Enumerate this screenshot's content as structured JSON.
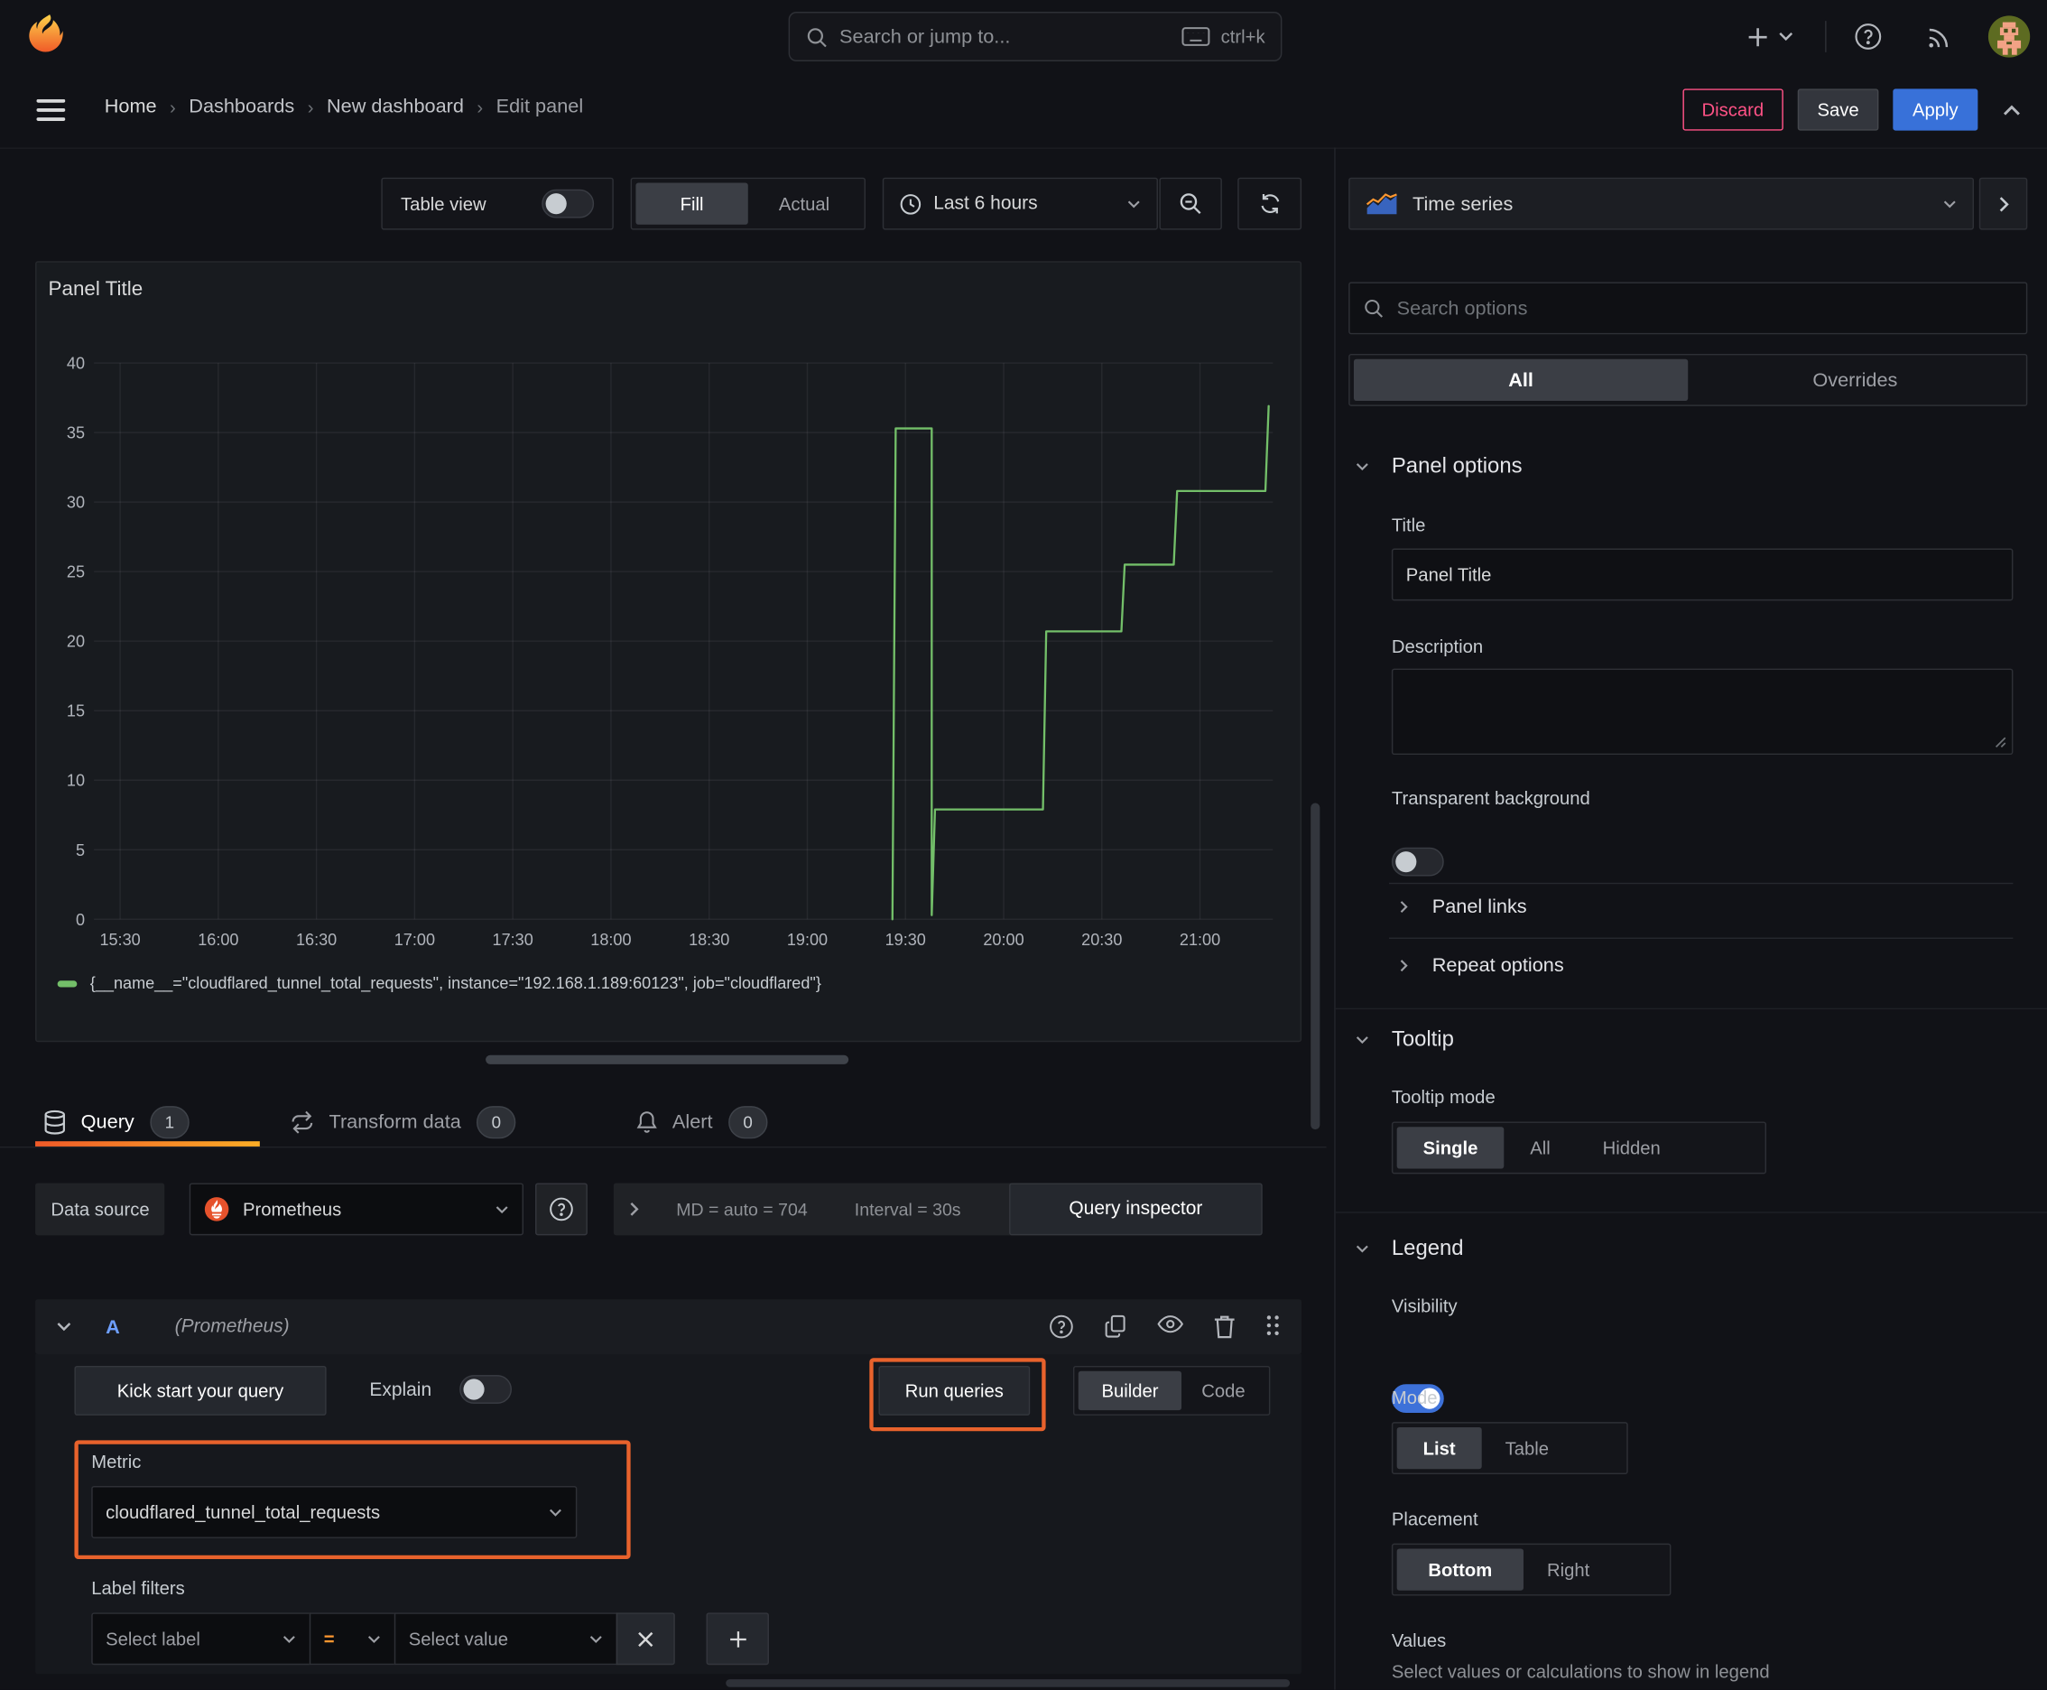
{
  "nav": {
    "search_placeholder": "Search or jump to...",
    "shortcut": "ctrl+k"
  },
  "breadcrumb": {
    "items": [
      "Home",
      "Dashboards",
      "New dashboard",
      "Edit panel"
    ],
    "discard": "Discard",
    "save": "Save",
    "apply": "Apply"
  },
  "toolbar": {
    "table_view": "Table view",
    "fill": "Fill",
    "actual": "Actual",
    "time_range": "Last 6 hours"
  },
  "panel": {
    "title": "Panel Title"
  },
  "chart_data": {
    "type": "line",
    "title": "Panel Title",
    "xlabel": "",
    "ylabel": "",
    "ylim": [
      0,
      40
    ],
    "y_ticks": [
      0,
      5,
      10,
      15,
      20,
      25,
      30,
      35,
      40
    ],
    "x_ticks": [
      "15:30",
      "16:00",
      "16:30",
      "17:00",
      "17:30",
      "18:00",
      "18:30",
      "19:00",
      "19:30",
      "20:00",
      "20:30",
      "21:00"
    ],
    "grid": true,
    "legend_position": "bottom",
    "series": [
      {
        "name": "{__name__=\"cloudflared_tunnel_total_requests\", instance=\"192.168.1.189:60123\", job=\"cloudflared\"}",
        "color": "#73bf69",
        "points": [
          [
            "19:26",
            0
          ],
          [
            "19:27",
            35.3
          ],
          [
            "19:38",
            35.3
          ],
          [
            "19:38",
            0.3
          ],
          [
            "19:39",
            7.9
          ],
          [
            "20:12",
            7.9
          ],
          [
            "20:13",
            20.7
          ],
          [
            "20:36",
            20.7
          ],
          [
            "20:37",
            25.5
          ],
          [
            "20:52",
            25.5
          ],
          [
            "20:53",
            30.8
          ],
          [
            "21:20",
            30.8
          ],
          [
            "21:21",
            36.9
          ]
        ]
      }
    ]
  },
  "tabs": {
    "query": "Query",
    "query_count": "1",
    "transform": "Transform data",
    "transform_count": "0",
    "alert": "Alert",
    "alert_count": "0"
  },
  "query": {
    "data_source_label": "Data source",
    "data_source": "Prometheus",
    "md": "MD = auto = 704",
    "interval": "Interval = 30s",
    "inspector": "Query inspector",
    "refid": "A",
    "ds_hint": "(Prometheus)",
    "kickstart": "Kick start your query",
    "explain": "Explain",
    "run": "Run queries",
    "builder": "Builder",
    "code": "Code",
    "metric_label": "Metric",
    "metric_value": "cloudflared_tunnel_total_requests",
    "label_filters": "Label filters",
    "select_label": "Select label",
    "operator": "=",
    "select_value": "Select value"
  },
  "sidebar": {
    "viz": "Time series",
    "search_placeholder": "Search options",
    "tab_all": "All",
    "tab_overrides": "Overrides",
    "panel_options": {
      "title": "Panel options",
      "title_label": "Title",
      "title_value": "Panel Title",
      "description_label": "Description",
      "transparent": "Transparent background"
    },
    "links": "Panel links",
    "repeat": "Repeat options",
    "tooltip": {
      "title": "Tooltip",
      "mode_label": "Tooltip mode",
      "options": [
        "Single",
        "All",
        "Hidden"
      ]
    },
    "legend": {
      "title": "Legend",
      "visibility": "Visibility",
      "mode_label": "Mode",
      "modes": [
        "List",
        "Table"
      ],
      "placement_label": "Placement",
      "placements": [
        "Bottom",
        "Right"
      ],
      "values_label": "Values",
      "values_hint": "Select values or calculations to show in legend"
    }
  },
  "colors": {
    "series_green": "#73bf69",
    "accent_orange": "#e8622c",
    "primary_blue": "#3871d9",
    "discard_pink": "#ff5286",
    "tab_underline_from": "#f05a28",
    "tab_underline_to": "#fbad26"
  }
}
